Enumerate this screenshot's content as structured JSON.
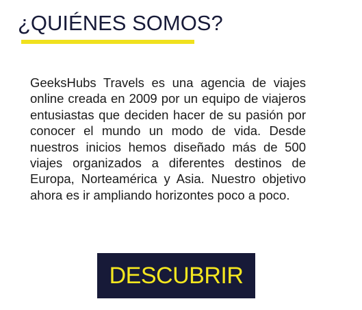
{
  "about": {
    "title": "¿QUIÉNES SOMOS?",
    "description": "GeeksHubs Travels es una agencia de viajes online creada en 2009 por un equipo de viaje­ros entusiastas que deciden hacer de su pasión por conocer el mundo un modo de vida. Desde nuestros inicios hemos diseñado más de 500 viajes organizados a diferentes destinos de Europa, Norteamérica y Asia. Nuestro objetivo ahora es ir ampliando hori­zontes poco a poco.",
    "cta_label": "DESCUBRIR"
  },
  "colors": {
    "accent_yellow": "#f0e11e",
    "button_bg": "#171a38",
    "button_text": "#f5e71f",
    "title_text": "#171a38"
  }
}
